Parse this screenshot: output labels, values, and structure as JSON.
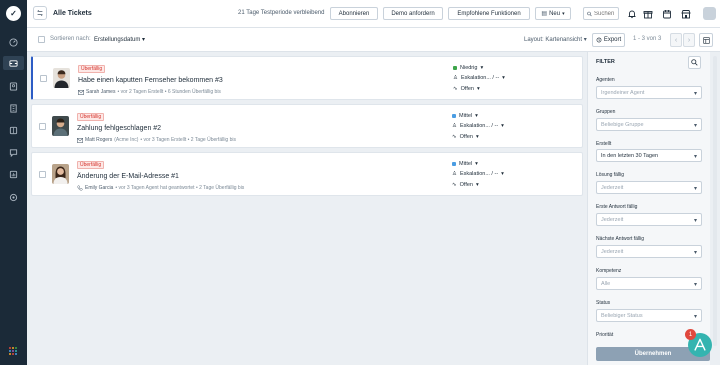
{
  "header": {
    "title": "Alle Tickets",
    "trial_text": "21 Tage Testperiode verbleibend",
    "subscribe_label": "Abonnieren",
    "demo_label": "Demo anfordern",
    "features_label": "Empfohlene Funktionen",
    "new_label": "Neu",
    "search_placeholder": "Suchen"
  },
  "toolbar": {
    "sort_label": "Sortieren nach:",
    "sort_value": "Erstellungsdatum",
    "layout_label": "Layout: Kartenansicht",
    "export_label": "Export",
    "pager_text": "1 - 3 von 3"
  },
  "tickets": [
    {
      "badge": "Überfällig",
      "title": "Habe einen kaputten Fernseher bekommen #3",
      "contact": "Sarah James",
      "meta": "• vor 2 Tagen Erstellt • 6 Stunden Überfällig bis",
      "priority": "Niedrig",
      "priority_color": "#3da54a",
      "group": "Eskalation... / --",
      "status": "Offen"
    },
    {
      "badge": "Überfällig",
      "title": "Zahlung fehlgeschlagen #2",
      "contact": "Matt Rogers",
      "contact_org": "(Acme Inc)",
      "meta": "• vor 3 Tagen Erstellt • 2 Tage Überfällig bis",
      "priority": "Mittel",
      "priority_color": "#4a9de3",
      "group": "Eskalation... / --",
      "status": "Offen"
    },
    {
      "badge": "Überfällig",
      "title": "Änderung der E-Mail-Adresse #1",
      "contact": "Emily Garcia",
      "meta": "• vor 3 Tagen Agent hat geantwortet • 2 Tage Überfällig bis",
      "priority": "Mittel",
      "priority_color": "#4a9de3",
      "group": "Eskalation... / --",
      "status": "Offen"
    }
  ],
  "filter": {
    "title": "FILTER",
    "fields": [
      {
        "label": "Agenten",
        "value": "Irgendeiner Agent",
        "filled": false
      },
      {
        "label": "Gruppen",
        "value": "Beliebige Gruppe",
        "filled": false
      },
      {
        "label": "Erstellt",
        "value": "In den letzten 30 Tagen",
        "filled": true
      },
      {
        "label": "Lösung fällig",
        "value": "Jederzeit",
        "filled": false
      },
      {
        "label": "Erste Antwort fällig",
        "value": "Jederzeit",
        "filled": false
      },
      {
        "label": "Nächste Antwort fällig",
        "value": "Jederzeit",
        "filled": false
      },
      {
        "label": "Kompetenz",
        "value": "Alle",
        "filled": false
      },
      {
        "label": "Status",
        "value": "Beliebiger Status",
        "filled": false
      },
      {
        "label": "Priorität",
        "value": "",
        "filled": false
      }
    ],
    "apply_label": "Übernehmen"
  },
  "notification_count": "1",
  "colors": {
    "rail": "#1b2a38",
    "overdue_text": "#d5362f",
    "apply_button": "#8da1b4",
    "fab": "#34b4b0"
  }
}
